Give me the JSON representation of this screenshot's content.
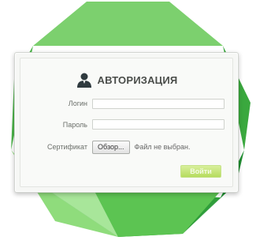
{
  "dialog": {
    "title": "АВТОРИЗАЦИЯ",
    "title_icon": "user-icon"
  },
  "form": {
    "login_label": "Логин",
    "login_value": "",
    "password_label": "Пароль",
    "password_value": "",
    "certificate_label": "Сертификат",
    "browse_label": "Обзор...",
    "file_status": "Файл не выбран.",
    "submit_label": "Войти"
  },
  "colors": {
    "accent_green": "#b5dc5e",
    "gem_dark": "#1e9a35",
    "gem_light": "#9be08a"
  }
}
